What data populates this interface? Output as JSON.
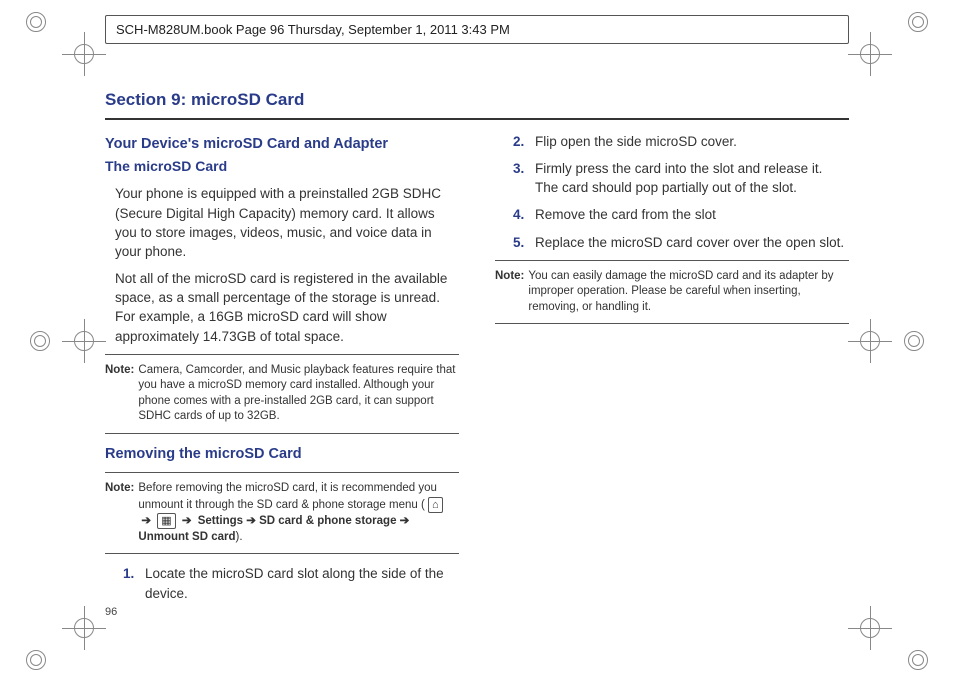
{
  "header": "SCH-M828UM.book  Page 96  Thursday, September 1, 2011  3:43 PM",
  "sectionTitle": "Section 9: microSD Card",
  "left": {
    "h1": "Your Device's microSD Card and Adapter",
    "h2": "The microSD Card",
    "p1": "Your phone is equipped with a preinstalled 2GB SDHC (Secure Digital High Capacity) memory card. It allows you to store images, videos, music, and voice data in your phone.",
    "p2": "Not all of the microSD card is registered in the available space, as a small percentage of the storage is unread. For example, a 16GB microSD card will show approximately 14.73GB of total space.",
    "note1Label": "Note:",
    "note1": "Camera, Camcorder, and Music playback features require that you have a microSD memory card installed. Although your phone comes with a pre-installed 2GB card, it can support SDHC cards of up to 32GB.",
    "h3": "Removing the microSD Card",
    "note2Label": "Note:",
    "note2a": "Before removing the microSD card, it is recommended you unmount it through the SD card & phone storage menu (",
    "note2b": "Settings ➔ SD card & phone storage ➔ Unmount SD card",
    "note2c": ").",
    "step1Num": "1.",
    "step1": "Locate the microSD card slot along the side of the device."
  },
  "right": {
    "step2Num": "2.",
    "step2": "Flip open the side microSD cover.",
    "step3Num": "3.",
    "step3": "Firmly press the card into the slot and release it. The card should pop partially out of the slot.",
    "step4Num": "4.",
    "step4": "Remove the card from the slot",
    "step5Num": "5.",
    "step5": "Replace the microSD card cover over the open slot.",
    "note3Label": "Note:",
    "note3": "You can easily damage the microSD card and its adapter by improper operation. Please be careful when inserting, removing, or handling it."
  },
  "pageNum": "96",
  "icons": {
    "home": "⌂",
    "grid": "▦"
  }
}
